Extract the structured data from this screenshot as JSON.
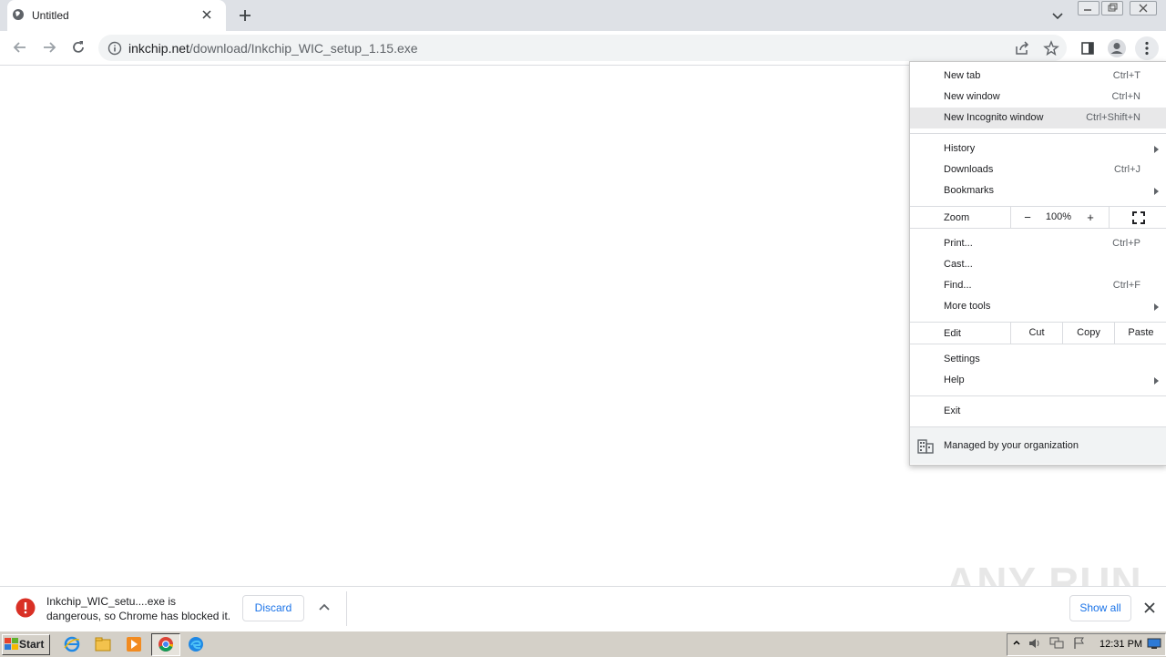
{
  "tab": {
    "title": "Untitled",
    "favicon": "globe-icon"
  },
  "omnibox": {
    "host": "inkchip.net",
    "path": "/download/Inkchip_WIC_setup_1.15.exe"
  },
  "menu": {
    "items_top": [
      {
        "label": "New tab",
        "shortcut": "Ctrl+T"
      },
      {
        "label": "New window",
        "shortcut": "Ctrl+N"
      },
      {
        "label": "New Incognito window",
        "shortcut": "Ctrl+Shift+N"
      }
    ],
    "items_mid": [
      {
        "label": "History",
        "shortcut": ""
      },
      {
        "label": "Downloads",
        "shortcut": "Ctrl+J"
      },
      {
        "label": "Bookmarks",
        "shortcut": ""
      }
    ],
    "zoom": {
      "label": "Zoom",
      "minus": "−",
      "value": "100%",
      "plus": "+"
    },
    "items_print": [
      {
        "label": "Print...",
        "shortcut": "Ctrl+P"
      },
      {
        "label": "Cast...",
        "shortcut": ""
      },
      {
        "label": "Find...",
        "shortcut": "Ctrl+F"
      },
      {
        "label": "More tools",
        "shortcut": ""
      }
    ],
    "edit": {
      "label": "Edit",
      "cut": "Cut",
      "copy": "Copy",
      "paste": "Paste"
    },
    "settings": "Settings",
    "help": "Help",
    "exit": "Exit",
    "managed": "Managed by your organization"
  },
  "download": {
    "line1": "Inkchip_WIC_setu....exe is",
    "line2": "dangerous, so Chrome has blocked it.",
    "discard": "Discard",
    "show_all": "Show all"
  },
  "taskbar": {
    "start": "Start",
    "clock": "12:31 PM"
  },
  "watermark": "ANY RUN",
  "colors": {
    "accent": "#1a73e8",
    "danger": "#d93025",
    "tabstrip": "#dee1e6",
    "taskbar": "#d4d0c8"
  }
}
